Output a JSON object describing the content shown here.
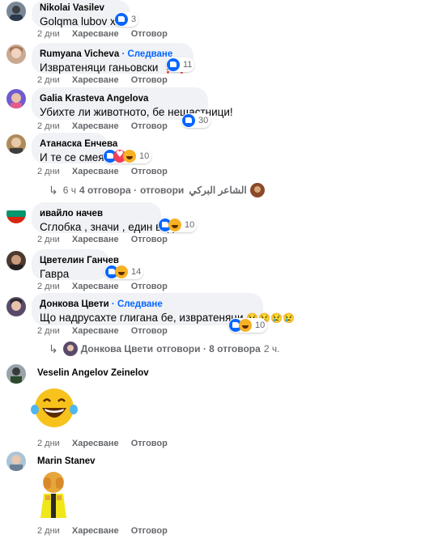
{
  "actions": {
    "like": "Харесване",
    "reply": "Отговор"
  },
  "comments": [
    {
      "author": "Nikolai Vasilev",
      "text": "Golqma lubov xaa",
      "time": "2 дни",
      "reaction_count": "3"
    },
    {
      "author": "Rumyana Vicheva",
      "follow": "Следване",
      "text": "Извратеняци ганьовски",
      "extra": "❗❗",
      "time": "2 дни",
      "reaction_count": "11"
    },
    {
      "author": "Galia Krasteva Angelova",
      "text": "Убихте ли животното, бе нещастници!",
      "time": "2 дни",
      "reaction_count": "30"
    },
    {
      "author": "Атанаска Енчева",
      "text": "И те се смеят?",
      "time": "2 дни",
      "reaction_count": "10"
    },
    {
      "author": "ивайло начев",
      "text": "Сглобка , значи , един вид .",
      "time": "2 дни",
      "reaction_count": "10"
    },
    {
      "author": "Цветелин Ганчев",
      "text": "Гавра",
      "time": "2 дни",
      "reaction_count": "14"
    },
    {
      "author": "Донкова Цвети",
      "follow": "Следване",
      "text": "Що надрусахте глигана бе, извратеняци",
      "extra": "😢😢😢😢",
      "time": "2 дни",
      "reaction_count": "10"
    },
    {
      "author": "Veselin Angelov Zeinelov",
      "time": "2 дни"
    },
    {
      "author": "Marin Stanev",
      "time": "2 дни"
    }
  ],
  "reply_threads": [
    {
      "name": "الشاعر البركي",
      "text": "4 отговора ·",
      "suffix": "отговори",
      "time": "6 ч"
    },
    {
      "name": "Донкова Цвети",
      "text": "отговори · 8 отговора",
      "time": "2 ч."
    }
  ],
  "colors": {
    "bubble": "#f0f2f5",
    "meta": "#65676b",
    "like": "#0866ff",
    "haha": "#f7b125",
    "love": "#f33e58"
  }
}
